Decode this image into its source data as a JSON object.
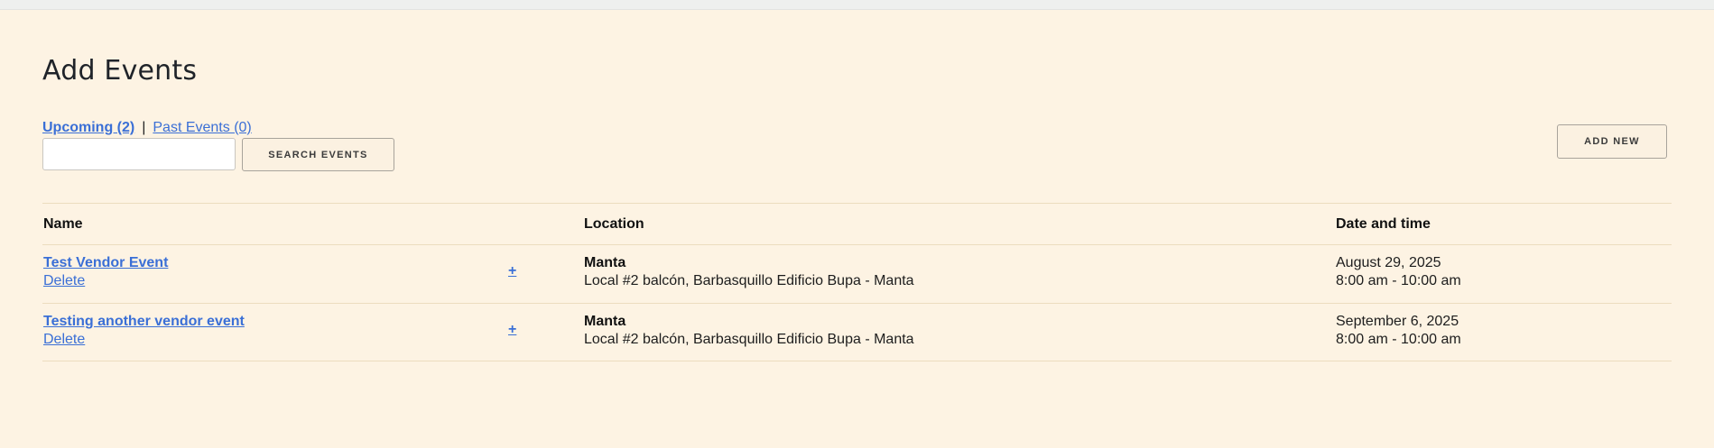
{
  "page": {
    "title": "Add Events"
  },
  "filters": {
    "upcoming_label": "Upcoming (2)",
    "separator": "|",
    "past_label": "Past Events (0)"
  },
  "search": {
    "placeholder": "",
    "value": "",
    "button_label": "SEARCH EVENTS"
  },
  "actions": {
    "add_new_label": "ADD NEW"
  },
  "table": {
    "headers": {
      "name": "Name",
      "location": "Location",
      "datetime": "Date and time"
    },
    "rows": [
      {
        "name": "Test Vendor Event",
        "delete": "Delete",
        "expand": "+",
        "city": "Manta",
        "address": "Local #2 balcón, Barbasquillo Edificio Bupa - Manta",
        "date": "August 29, 2025",
        "time": "8:00 am - 10:00 am"
      },
      {
        "name": "Testing another vendor event",
        "delete": "Delete",
        "expand": "+",
        "city": "Manta",
        "address": "Local #2 balcón, Barbasquillo Edificio Bupa - Manta",
        "date": "September 6, 2025",
        "time": "8:00 am - 10:00 am"
      }
    ]
  },
  "colors": {
    "background": "#fdf3e3",
    "link": "#3a6fd6",
    "border": "#ecdcbf"
  }
}
